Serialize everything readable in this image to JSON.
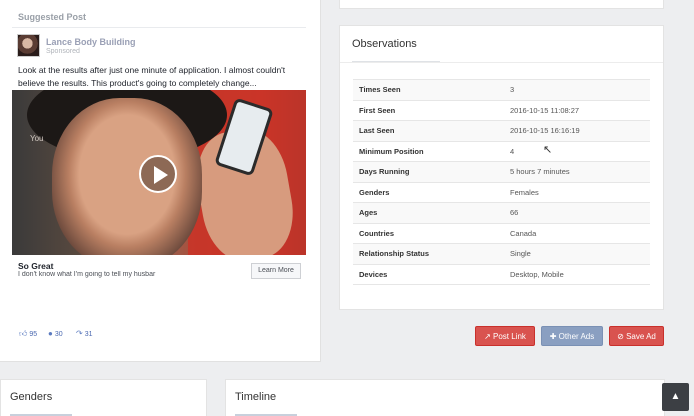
{
  "post": {
    "suggested_label": "Suggested Post",
    "page_name": "Lance Body Building",
    "sponsored_label": "Sponsored",
    "text": "Look at the results after just one minute of application. I almost couldn't believe the results. This product's going to completely change...",
    "video_overlay_text": "You",
    "link_title": "So Great",
    "link_description": "I don't know what I'm going to tell my husbar",
    "cta_label": "Learn More",
    "reactions": {
      "likes": "95",
      "comments": "30",
      "shares": "31"
    },
    "icons": {
      "like": "thumbs-up-icon",
      "comment": "comment-icon",
      "share": "share-icon",
      "play": "play-icon"
    }
  },
  "observations": {
    "title": "Observations",
    "rows": [
      {
        "key": "Times Seen",
        "value": "3"
      },
      {
        "key": "First Seen",
        "value": "2016-10-15 11:08:27"
      },
      {
        "key": "Last Seen",
        "value": "2016-10-15 16:16:19"
      },
      {
        "key": "Minimum Position",
        "value": "4"
      },
      {
        "key": "Days Running",
        "value": "5 hours 7 minutes"
      },
      {
        "key": "Genders",
        "value": "Females"
      },
      {
        "key": "Ages",
        "value": "66"
      },
      {
        "key": "Countries",
        "value": "Canada"
      },
      {
        "key": "Relationship Status",
        "value": "Single"
      },
      {
        "key": "Devices",
        "value": "Desktop, Mobile"
      }
    ]
  },
  "actions": {
    "post_link": "Post Link",
    "other_ads": "Other Ads",
    "save_ad": "Save Ad"
  },
  "sections": {
    "genders_title": "Genders",
    "timeline_title": "Timeline"
  },
  "colors": {
    "danger": "#d9534f",
    "muted_blue": "#8a9fc1",
    "facebook_blue": "#4a68b0"
  }
}
